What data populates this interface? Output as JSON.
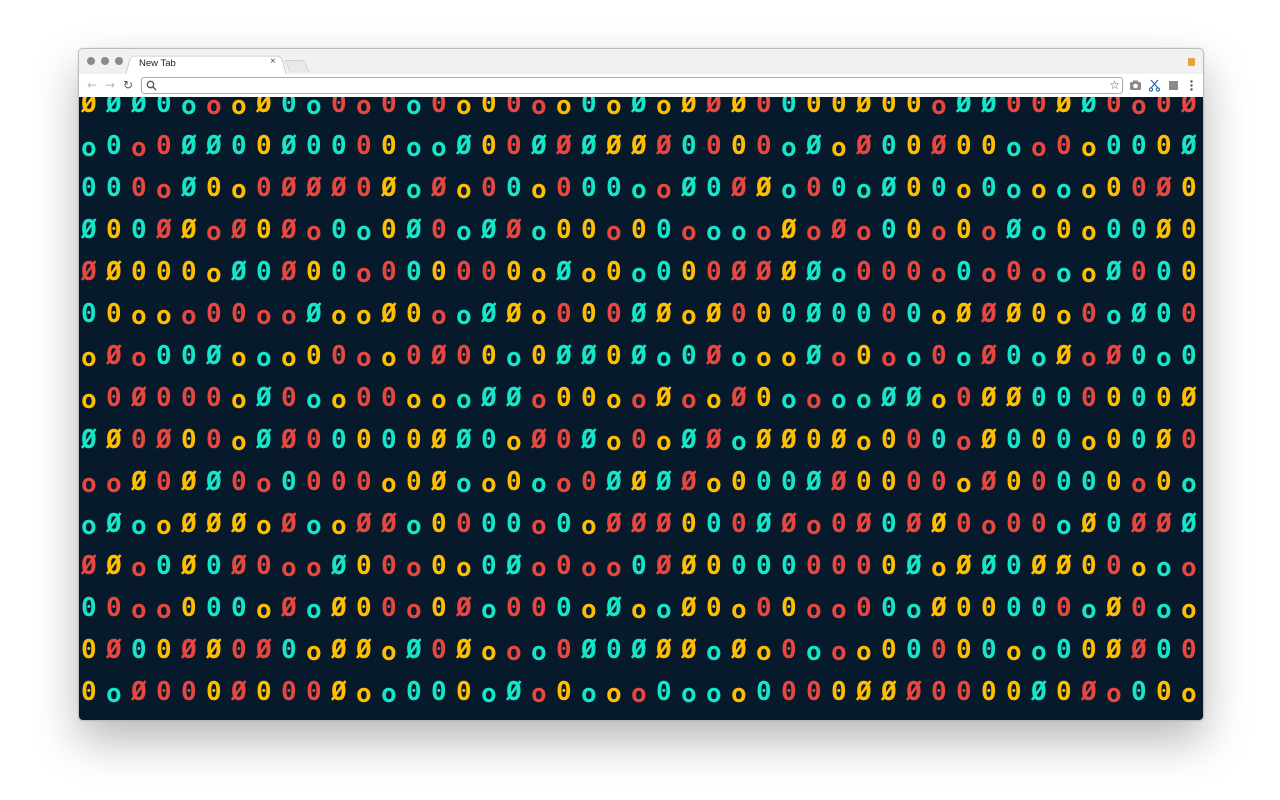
{
  "browser": {
    "tab": {
      "title": "New Tab",
      "close_symbol": "×"
    },
    "toolbar": {
      "back_icon": "arrow-left-icon",
      "forward_icon": "arrow-right-icon",
      "reload_icon": "reload-icon",
      "search_icon": "search-icon",
      "bookmark_icon": "star-icon",
      "address_value": "",
      "extensions": [
        "camera-icon",
        "scissors-icon",
        "square-icon",
        "menu-dots-icon"
      ]
    }
  },
  "wallpaper": {
    "background": "#071a2c",
    "palette": [
      "#ffbe00",
      "#e8473f",
      "#15e6c8"
    ],
    "glyphs": [
      "0",
      "Ø",
      "o"
    ],
    "description_none": ""
  }
}
